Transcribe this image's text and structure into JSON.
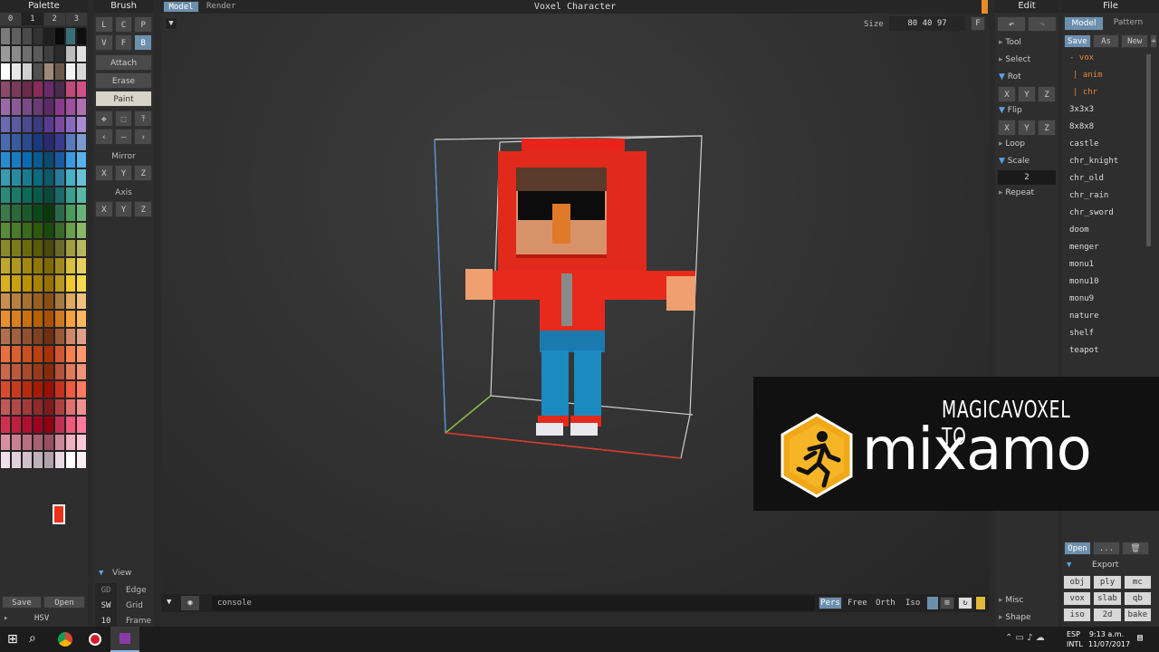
{
  "window": {
    "title": "Voxel Character",
    "tabs": [
      "Model",
      "Render"
    ]
  },
  "palette": {
    "title": "Palette",
    "tabs": [
      "0",
      "1",
      "2",
      "3"
    ],
    "colors": [
      "#7a7a7a",
      "#5f5f5f",
      "#4a4a4a",
      "#333333",
      "#1f1f1f",
      "#0a0a0a",
      "#3a6f7a",
      "#101010",
      "#9a9a9a",
      "#8a8a8a",
      "#6f6f6f",
      "#5a5a5a",
      "#3f3f3f",
      "#2a2a2a",
      "#bdbdbd",
      "#e0e0e0",
      "#ffffff",
      "#e8e8e8",
      "#d0d0d0",
      "#505050",
      "#9e8a7a",
      "#6a5a4a",
      "#f2f2f2",
      "#d8d8d8",
      "#8a4a6a",
      "#7a3a5a",
      "#6a2a4a",
      "#8a2a5a",
      "#6a2a6a",
      "#4a2a4a",
      "#c04a7a",
      "#d0508a",
      "#9a6aa8",
      "#8a5a98",
      "#7a4a88",
      "#6a3a78",
      "#5a2a68",
      "#8a3a8a",
      "#a050a0",
      "#b070b0",
      "#6a6ab0",
      "#5a5aa0",
      "#4a4a90",
      "#3a3a80",
      "#5a3a90",
      "#7a4aa0",
      "#8a6ac0",
      "#aa8ad0",
      "#4a6ab0",
      "#3a5aa0",
      "#2a4a90",
      "#1a3a80",
      "#2a2a70",
      "#3a3a90",
      "#5a7ac0",
      "#7a9ad0",
      "#2a8ad0",
      "#1a7ac0",
      "#0a6ab0",
      "#0a5a90",
      "#0a4a70",
      "#1a5aa0",
      "#3a9ae0",
      "#5ab0e8",
      "#3a9ab0",
      "#2a8aa0",
      "#1a7a90",
      "#0a6a80",
      "#0a5a6a",
      "#2a7a9a",
      "#4ab0c8",
      "#6ac0d8",
      "#2a8a7a",
      "#1a7a6a",
      "#0a6a5a",
      "#0a5a4a",
      "#0a4a3a",
      "#1a6a6a",
      "#3aa090",
      "#5ab8a8",
      "#3a7a4a",
      "#2a6a3a",
      "#1a5a2a",
      "#0a4a1a",
      "#0a3a0a",
      "#2a6a4a",
      "#4a9a5a",
      "#6ab07a",
      "#5a8a3a",
      "#4a7a2a",
      "#3a6a1a",
      "#2a5a0a",
      "#1a4a0a",
      "#3a6a2a",
      "#6aa04a",
      "#8ab86a",
      "#8a8a2a",
      "#7a7a1a",
      "#6a6a0a",
      "#5a5a0a",
      "#4a4a0a",
      "#6a6a2a",
      "#a0a040",
      "#b8b860",
      "#c0a830",
      "#b09820",
      "#a08810",
      "#907800",
      "#806800",
      "#a08a20",
      "#d8c040",
      "#e8d060",
      "#d8b020",
      "#c8a010",
      "#b89000",
      "#a88000",
      "#987000",
      "#b89820",
      "#f0c830",
      "#f8d850",
      "#c89050",
      "#b88040",
      "#a87030",
      "#986020",
      "#885010",
      "#a87a40",
      "#e0a860",
      "#f0c080",
      "#e89030",
      "#d88020",
      "#c87010",
      "#b86000",
      "#a85000",
      "#d07820",
      "#f8a040",
      "#ffb860",
      "#b07050",
      "#a06040",
      "#905030",
      "#804020",
      "#703010",
      "#9a5a3a",
      "#d08868",
      "#e0a088",
      "#e87040",
      "#d86030",
      "#c85020",
      "#b84010",
      "#a83000",
      "#d05830",
      "#f88050",
      "#ff9870",
      "#c86a4a",
      "#b85a3a",
      "#a84a2a",
      "#983a1a",
      "#882a0a",
      "#b8503a",
      "#e07a5a",
      "#f0947a",
      "#d84a30",
      "#c83a20",
      "#b82a10",
      "#a81a00",
      "#981000",
      "#c83020",
      "#f05a40",
      "#ff7a60",
      "#c05a5a",
      "#b04a4a",
      "#a03a3a",
      "#902a2a",
      "#801a1a",
      "#b04040",
      "#e07070",
      "#f09090",
      "#d03050",
      "#c02040",
      "#b01030",
      "#a00020",
      "#900010",
      "#c03050",
      "#f05a7a",
      "#ff7a9a",
      "#d890a0",
      "#c88090",
      "#b87080",
      "#a86070",
      "#985060",
      "#c88898",
      "#f0b0c0",
      "#ffc8d8",
      "#f0e0e8",
      "#e0d0d8",
      "#d0c0c8",
      "#c0b0b8",
      "#b0a0a8",
      "#e8d8e0",
      "#ffffff",
      "#f8f0f4"
    ],
    "save_label": "Save",
    "open_label": "Open",
    "hsv_label": "HSV"
  },
  "brush": {
    "title": "Brush",
    "modes1": [
      "L",
      "C",
      "P"
    ],
    "modes2": [
      "V",
      "F",
      "B"
    ],
    "actions": [
      "Attach",
      "Erase",
      "Paint"
    ],
    "mirror_label": "Mirror",
    "axis_label": "Axis",
    "xyz": [
      "X",
      "Y",
      "Z"
    ]
  },
  "viewport": {
    "size_label": "Size",
    "size_value": "80 40 97",
    "f_label": "F",
    "console_text": "console",
    "camera_modes": [
      "Pers",
      "Free",
      "Orth",
      "Iso"
    ]
  },
  "view_panel": {
    "title": "View",
    "items": [
      {
        "key": "GD",
        "label": "Edge"
      },
      {
        "key": "SW",
        "label": "Grid"
      },
      {
        "key": "10",
        "label": "Frame"
      }
    ]
  },
  "edit": {
    "title": "Edit",
    "items": [
      "Tool",
      "Select",
      "Rot",
      "Flip",
      "Loop",
      "Scale",
      "Repeat"
    ],
    "xyz": [
      "X",
      "Y",
      "Z"
    ],
    "scale_value": "2",
    "misc_label": "Misc",
    "shape_label": "Shape"
  },
  "file": {
    "title": "File",
    "tabs": [
      "Model",
      "Pattern"
    ],
    "actions": [
      "Save",
      "As",
      "New",
      "+"
    ],
    "tree": [
      "- vox",
      "| anim",
      "| chr"
    ],
    "files": [
      "3x3x3",
      "8x8x8",
      "castle",
      "chr_knight",
      "chr_old",
      "chr_rain",
      "chr_sword",
      "doom",
      "menger",
      "monu1",
      "monu10",
      "monu9",
      "nature",
      "shelf",
      "teapot"
    ],
    "open_label": "Open",
    "dots_label": "...",
    "export_label": "Export",
    "export_formats": [
      "obj",
      "ply",
      "mc",
      "vox",
      "slab",
      "qb",
      "iso",
      "2d",
      "bake"
    ]
  },
  "overlay": {
    "line1": "MAGICAVOXEL TO",
    "line2": "mixamo"
  },
  "taskbar": {
    "lang1": "ESP",
    "lang2": "INTL",
    "time": "9:13 a.m.",
    "date": "11/07/2017"
  },
  "colors": {
    "accent": "#6d8fae",
    "selected_red": "#e8311a",
    "panel": "#2e2e2e"
  }
}
